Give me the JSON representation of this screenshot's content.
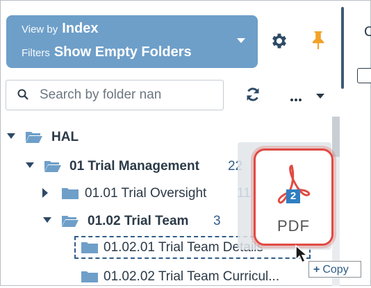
{
  "view": {
    "view_by_label": "View by",
    "view_by_value": "Index",
    "filters_label": "Filters",
    "filters_value": "Show Empty Folders"
  },
  "right_panel": {
    "partial_letter": "C"
  },
  "search": {
    "placeholder": "Search by folder nan"
  },
  "tree": {
    "root": {
      "label": "HAL"
    },
    "trial_management": {
      "label": "01 Trial Management",
      "count": "22"
    },
    "trial_oversight": {
      "label": "01.01 Trial Oversight",
      "count": "11"
    },
    "trial_team": {
      "label": "01.02 Trial Team",
      "count": "3"
    },
    "trial_team_details": {
      "label": "01.02.01 Trial Team Details"
    },
    "trial_team_curricula": {
      "label": "01.02.02 Trial Team Curricul..."
    }
  },
  "drag": {
    "pdf_label": "PDF",
    "badge_count": "2",
    "copy_tip": "Copy"
  },
  "colors": {
    "view_box": "#6e9fc9",
    "pdf_border": "#e04a43",
    "folder": "#6e9fc9",
    "pin": "#f2a227",
    "count": "#2f5c88"
  }
}
